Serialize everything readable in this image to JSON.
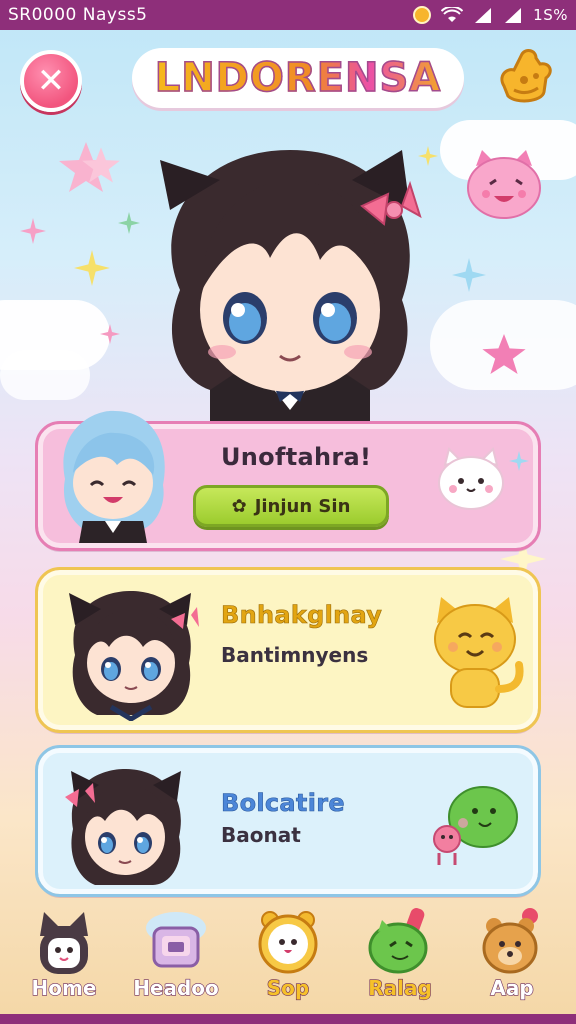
{
  "status_bar": {
    "carrier": "SR0000 Nayss5",
    "battery": "1S%"
  },
  "header": {
    "title": "LNDORENSA"
  },
  "cards": [
    {
      "title": "Unoftahra!",
      "button_label": "Jinjun Sin"
    },
    {
      "title": "Bnhakglnay",
      "subtitle": "Bantimnyens"
    },
    {
      "title": "Bolcatire",
      "subtitle": "Baonat"
    }
  ],
  "bottom_nav": [
    {
      "label": "Home",
      "icon": "home-icon"
    },
    {
      "label": "Headoo",
      "icon": "tv-icon"
    },
    {
      "label": "Sop",
      "icon": "clock-icon"
    },
    {
      "label": "Ralag",
      "icon": "dino-icon"
    },
    {
      "label": "Aap",
      "icon": "bear-icon"
    }
  ],
  "colors": {
    "status_bar": "#8e2f7a",
    "card_1": "#f6bedc",
    "card_2": "#fdf5c3",
    "card_3": "#dcf1fb",
    "play_button": "#b5dc45",
    "title_gold": "#f6b81c",
    "card_title_gold": "#e2a512",
    "card_title_blue": "#4c86d8"
  }
}
